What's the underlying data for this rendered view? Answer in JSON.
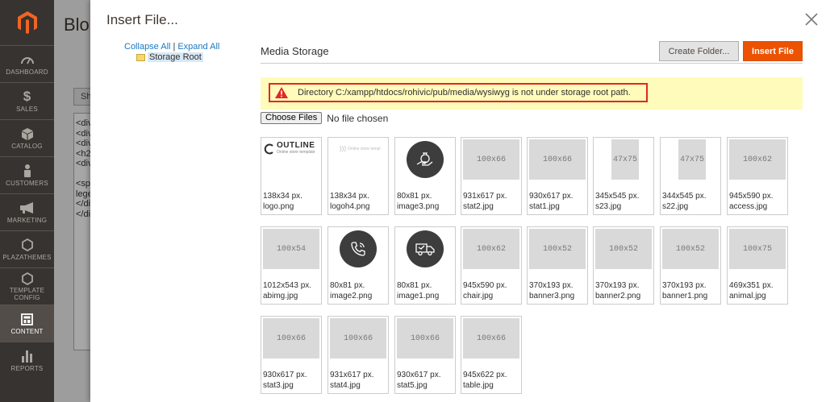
{
  "admin_nav": {
    "items": [
      {
        "label": "DASHBOARD",
        "icon": "dashboard-icon"
      },
      {
        "label": "SALES",
        "icon": "dollar-icon"
      },
      {
        "label": "CATALOG",
        "icon": "box-icon"
      },
      {
        "label": "CUSTOMERS",
        "icon": "person-icon"
      },
      {
        "label": "MARKETING",
        "icon": "megaphone-icon"
      },
      {
        "label": "PLAZATHEMES",
        "icon": "hexagon-icon"
      },
      {
        "label": "TEMPLATE CONFIG",
        "icon": "hexagon-icon"
      },
      {
        "label": "CONTENT",
        "icon": "layout-icon"
      },
      {
        "label": "REPORTS",
        "icon": "bar-chart-icon"
      }
    ],
    "active": "CONTENT"
  },
  "background_page": {
    "title": "Blo",
    "button_label": "Sh",
    "editor_lines": [
      "<div",
      "<div",
      "<div",
      "<h2",
      "<div",
      "",
      "<spa",
      "lege",
      "</di",
      "</di"
    ]
  },
  "modal": {
    "title": "Insert File...",
    "tree": {
      "collapse_all": "Collapse All",
      "separator": "|",
      "expand_all": "Expand All",
      "root_label": "Storage Root"
    },
    "media_heading": "Media Storage",
    "create_folder_label": "Create Folder...",
    "insert_file_label": "Insert File",
    "warning_text": "Directory C:/xampp/htdocs/rohivic/pub/media/wysiwyg is not under storage root path.",
    "choose_files_label": "Choose Files",
    "no_file_text": "No file chosen"
  },
  "files": [
    {
      "size": "138x34 px.",
      "name": "logo.png",
      "thumb": "logo-outline",
      "thumb_text": "OUTLINE",
      "thumb_sub": "Online store template"
    },
    {
      "size": "138x34 px.",
      "name": "logoh4.png",
      "thumb": "logo-light",
      "thumb_text": "Online store templ"
    },
    {
      "size": "80x81 px.",
      "name": "image3.png",
      "thumb": "circle",
      "icon": "hand-money-icon"
    },
    {
      "size": "931x617 px.",
      "name": "stat2.jpg",
      "thumb": "gray",
      "thumb_text": "100x66"
    },
    {
      "size": "930x617 px.",
      "name": "stat1.jpg",
      "thumb": "gray",
      "thumb_text": "100x66"
    },
    {
      "size": "345x545 px.",
      "name": "s23.jpg",
      "thumb": "gray-narrow",
      "thumb_text": "47x75"
    },
    {
      "size": "344x545 px.",
      "name": "s22.jpg",
      "thumb": "gray-narrow",
      "thumb_text": "47x75"
    },
    {
      "size": "945x590 px.",
      "name": "access.jpg",
      "thumb": "gray",
      "thumb_text": "100x62"
    },
    {
      "size": "1012x543 px.",
      "name": "abimg.jpg",
      "thumb": "gray",
      "thumb_text": "100x54"
    },
    {
      "size": "80x81 px.",
      "name": "image2.png",
      "thumb": "circle",
      "icon": "phone-icon"
    },
    {
      "size": "80x81 px.",
      "name": "image1.png",
      "thumb": "circle",
      "icon": "truck-icon"
    },
    {
      "size": "945x590 px.",
      "name": "chair.jpg",
      "thumb": "gray",
      "thumb_text": "100x62"
    },
    {
      "size": "370x193 px.",
      "name": "banner3.png",
      "thumb": "gray",
      "thumb_text": "100x52"
    },
    {
      "size": "370x193 px.",
      "name": "banner2.png",
      "thumb": "gray",
      "thumb_text": "100x52"
    },
    {
      "size": "370x193 px.",
      "name": "banner1.png",
      "thumb": "gray",
      "thumb_text": "100x52"
    },
    {
      "size": "469x351 px.",
      "name": "animal.jpg",
      "thumb": "gray",
      "thumb_text": "100x75"
    },
    {
      "size": "930x617 px.",
      "name": "stat3.jpg",
      "thumb": "gray",
      "thumb_text": "100x66"
    },
    {
      "size": "931x617 px.",
      "name": "stat4.jpg",
      "thumb": "gray",
      "thumb_text": "100x66"
    },
    {
      "size": "930x617 px.",
      "name": "stat5.jpg",
      "thumb": "gray",
      "thumb_text": "100x66"
    },
    {
      "size": "945x622 px.",
      "name": "table.jpg",
      "thumb": "gray",
      "thumb_text": "100x66"
    }
  ],
  "colors": {
    "accent": "#eb5202",
    "sidebar": "#373330",
    "warning_bg": "#fffbbb",
    "warning_border": "#e22626",
    "link": "#1979c3"
  }
}
